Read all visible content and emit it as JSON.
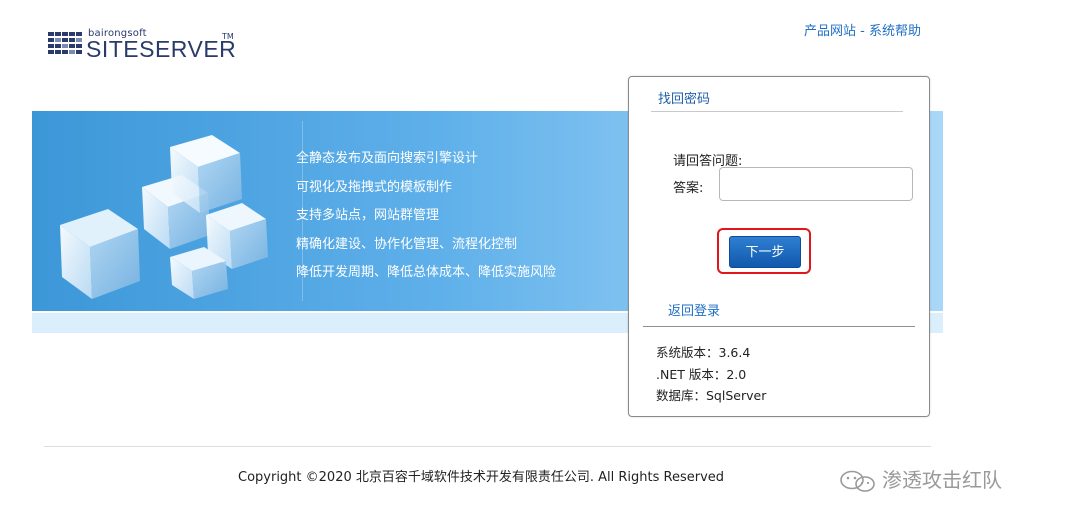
{
  "logo": {
    "small_text": "bairongsoft",
    "big_text": "SITESERVER",
    "tm": "TM"
  },
  "top_links": {
    "product_site": "产品网站",
    "separator": " - ",
    "help": "系统帮助"
  },
  "banner": {
    "features": [
      "全静态发布及面向搜索引擎设计",
      "可视化及拖拽式的模板制作",
      "支持多站点，网站群管理",
      "精确化建设、协作化管理、流程化控制",
      "降低开发周期、降低总体成本、降低实施风险"
    ]
  },
  "panel": {
    "title": "找回密码",
    "question_label": "请回答问题:",
    "answer_label": "答案:",
    "answer_value": "",
    "next_button": "下一步",
    "back_link": "返回登录",
    "info": {
      "system_version": "系统版本：3.6.4",
      "net_version": ".NET 版本：2.0",
      "database": "数据库：SqlServer"
    }
  },
  "footer": {
    "copyright": "Copyright ©2020 北京百容千域软件技术开发有限责任公司. All Rights Reserved"
  },
  "watermark": {
    "text": "渗透攻击红队",
    "icon": "wechat-icon"
  },
  "colors": {
    "link_blue": "#1f6fc5",
    "button_blue": "#1159ad",
    "highlight_red": "#e0161b",
    "banner_blue": "#3c97d8"
  }
}
